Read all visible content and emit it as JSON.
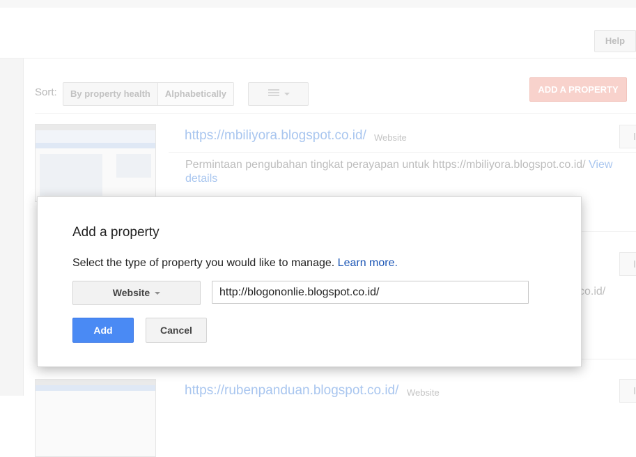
{
  "header": {
    "help_label": "Help"
  },
  "toolbar": {
    "sort_label": "Sort:",
    "sort_options": [
      "By property health",
      "Alphabetically"
    ],
    "view_icon": "list-view-icon",
    "add_property_label": "ADD A PROPERTY"
  },
  "properties": [
    {
      "url": "https://mbiliyora.blogspot.co.id/",
      "type": "Website",
      "message": "Permintaan pengubahan tingkat perayapan untuk https://mbiliyora.blogspot.co.id/",
      "message_link": "View details"
    },
    {
      "partial_text": "co.id/"
    },
    {
      "url": "https://rubenpanduan.blogspot.co.id/",
      "type": "Website"
    }
  ],
  "dialog": {
    "title": "Add a property",
    "description": "Select the type of property you would like to manage.",
    "learn_more": "Learn more.",
    "type_value": "Website",
    "url_value": "http://blogononlie.blogspot.co.id/",
    "add_label": "Add",
    "cancel_label": "Cancel"
  },
  "colors": {
    "primary": "#4a8af4",
    "add_property": "#f8d2cc",
    "link": "#1a55b5"
  }
}
